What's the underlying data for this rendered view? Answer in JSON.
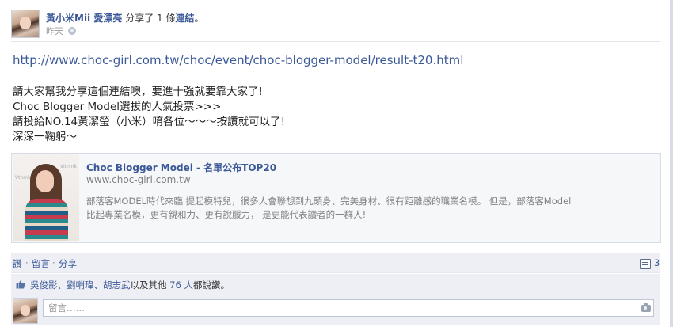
{
  "post": {
    "author": "黃小米Mii 愛漂亮",
    "shared_text": "分享了 1 條",
    "link_word": "連結",
    "period": "。",
    "time": "昨天",
    "url": "http://www.choc-girl.com.tw/choc/event/choc-blogger-model/result-t20.html",
    "message_lines": [
      "請大家幫我分享這個連結噢，要進十強就要靠大家了!",
      "Choc Blogger Model選拔的人氣投票>>>",
      "請投給NO.14黃潔瑩（小米）唷各位～～～按讚就可以了!",
      "深深一鞠躬～"
    ]
  },
  "attachment": {
    "title": "Choc Blogger Model - 名單公布TOP20",
    "domain": "www.choc-girl.com.tw",
    "desc_lines": [
      "部落客MODEL時代來臨 提起模特兒，很多人會聯想到九頭身、完美身材、很有距離感的職業名模。 但是，部落客Model",
      "比起專業名模，更有親和力、更有說服力， 是更能代表讀者的一群人!"
    ],
    "thumb_brand": "Vthmk",
    "thumb_brand2": "Vithmk"
  },
  "actions": {
    "like": "讚",
    "comment": "留言",
    "share": "分享",
    "separator": "·",
    "comment_count": "3"
  },
  "likes": {
    "names": "吳俊影、劉哨瑋、胡志武",
    "middle": "以及其他",
    "others": "76 人",
    "suffix": "都說讚。"
  },
  "comment_box": {
    "placeholder": "留言……"
  }
}
